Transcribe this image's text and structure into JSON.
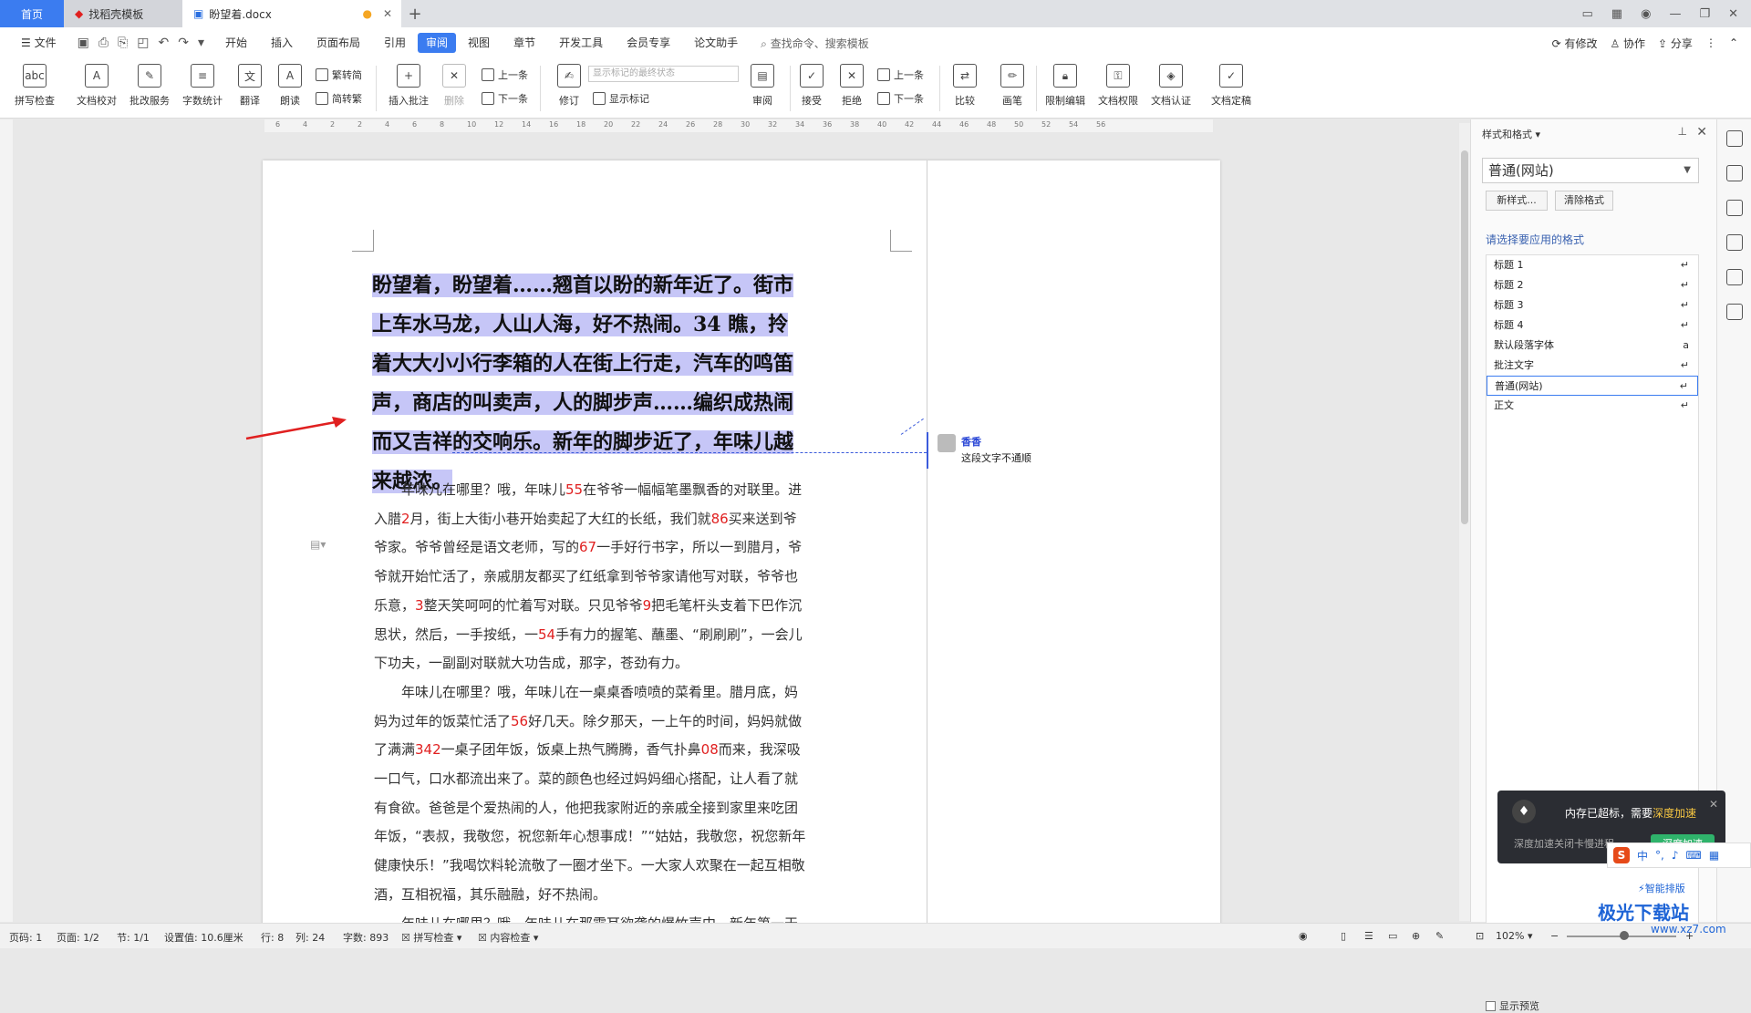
{
  "tabs": {
    "home": "首页",
    "template": "找稻壳模板",
    "doc": "盼望着.docx",
    "modified_dot": "●",
    "plus": "+"
  },
  "menu": {
    "file": "文件",
    "items": [
      "开始",
      "插入",
      "页面布局",
      "引用",
      "审阅",
      "视图",
      "章节",
      "开发工具",
      "会员专享",
      "论文助手"
    ],
    "active_index": 4,
    "search": "查找命令、搜索模板",
    "right": [
      "有修改",
      "协作",
      "分享"
    ]
  },
  "ribbon": {
    "buttons": [
      "拼写检查",
      "文档校对",
      "批改服务",
      "字数统计",
      "翻译",
      "朗读",
      "插入批注",
      "删除",
      "修订",
      "审阅",
      "接受",
      "拒绝",
      "比较",
      "画笔",
      "限制编辑",
      "文档权限",
      "文档认证",
      "文档定稿"
    ],
    "small": {
      "trad": "繁转简",
      "simp": "简转繁",
      "prev1": "上一条",
      "next1": "下一条",
      "show_mark": "显示标记",
      "prev2": "上一条",
      "next2": "下一条"
    },
    "select_placeholder": "显示标记的最终状态"
  },
  "ruler": {
    "ticks": [
      "6",
      "4",
      "2",
      "2",
      "4",
      "6",
      "8",
      "10",
      "12",
      "14",
      "16",
      "18",
      "20",
      "22",
      "24",
      "26",
      "28",
      "30",
      "32",
      "34",
      "36",
      "38",
      "40",
      "42",
      "44",
      "46",
      "48",
      "50",
      "52",
      "54",
      "56"
    ]
  },
  "document": {
    "selected_paragraph": "盼望着，盼望着……翘首以盼的新年近了。街市上车水马龙，人山人海，好不热闹。34 瞧，拎着大大小小行李箱的人在街上行走，汽车的鸣笛声，商店的叫卖声，人的脚步声……编织成热闹而又吉祥的交响乐。新年的脚步近了，年味儿越来越浓。",
    "p1": [
      {
        "t": "年味儿在哪里？哦，年味儿"
      },
      {
        "t": "55",
        "red": true
      },
      {
        "t": "在爷爷一幅幅笔墨飘香的对联里。进入腊"
      },
      {
        "t": "2",
        "red": true
      },
      {
        "t": "月，街上大街小巷开始卖起了大红的长纸，我们就"
      },
      {
        "t": "86",
        "red": true
      },
      {
        "t": "买来送到爷爷家。爷爷曾经是语文老师，写的"
      },
      {
        "t": "67",
        "red": true
      },
      {
        "t": "一手好行书字，所以一到腊月，爷爷就开始忙活了，亲戚朋友都买了红纸拿到爷爷家请他写对联，爷爷也乐意，"
      },
      {
        "t": "3",
        "red": true
      },
      {
        "t": "整天笑呵呵的忙着写对联。只见爷爷"
      },
      {
        "t": "9",
        "red": true
      },
      {
        "t": "把毛笔杆头支着下巴作沉思状，然后，一手按纸，一"
      },
      {
        "t": "54",
        "red": true
      },
      {
        "t": "手有力的握笔、蘸墨、“刷刷刷”，一会儿下功夫，一副副对联就大功告成，那字，苍劲有力。"
      }
    ],
    "p2": [
      {
        "t": "年味儿在哪里？哦，年味儿在一桌桌香喷喷的菜肴里。腊月底，妈妈为过年的饭菜忙活了"
      },
      {
        "t": "56",
        "red": true
      },
      {
        "t": "好几天。除夕那天，一上午的时间，妈妈就做了满满"
      },
      {
        "t": "342",
        "red": true
      },
      {
        "t": "一桌子团年饭，饭桌上热气腾腾，香气扑鼻"
      },
      {
        "t": "08",
        "red": true
      },
      {
        "t": "而来，我深吸一口气，口水都流出来了。菜的颜色也经过妈妈细心搭配，让人看了就有食欲。爸爸是个爱热闹的人，他把我家附近的亲戚全接到家里来吃团年饭，“表叔，我敬您，祝您新年心想事成！”“姑姑，我敬您，祝您新年健康快乐！”我喝饮料轮流敬了一圈才坐下。一大家人欢聚在一起互相敬酒，互相祝福，其乐融融，好不热闹。"
      }
    ],
    "p3": [
      {
        "t": "年味儿在哪里？哦，年味儿在那震耳欲聋的爆竹声中。新年第一天零点开始，大伙便迫不及待，家家户户老老少少都带起了礼炮烟花。"
      }
    ]
  },
  "comment": {
    "author": "香香",
    "text": "这段文字不通顺"
  },
  "panel": {
    "title": "样式和格式",
    "current_style": "普通(网站)",
    "new_style": "新样式...",
    "clear_format": "清除格式",
    "choose_label": "请选择要应用的格式",
    "styles": [
      "标题 1",
      "标题 2",
      "标题 3",
      "标题 4",
      "默认段落字体",
      "批注文字",
      "普通(网站)",
      "正文"
    ],
    "selected_style": "普通(网站)",
    "show_label": "显示",
    "preview": "显示预览",
    "smart": "智能排版"
  },
  "toast": {
    "message": "内存已超标，需要",
    "highlight": "深度加速",
    "sub": "深度加速关闭卡慢进程",
    "action": "深度加速"
  },
  "ime": {
    "logo": "S",
    "mode": "中"
  },
  "status": {
    "page_num": "页码: 1",
    "page": "页面: 1/2",
    "section": "节: 1/1",
    "setting": "设置值: 10.6厘米",
    "row": "行: 8",
    "col": "列: 24",
    "words": "字数: 893",
    "spell": "拼写检查",
    "content": "内容检查",
    "zoom": "102%"
  },
  "watermark": {
    "name": "极光下载站",
    "url": "www.xz7.com"
  }
}
